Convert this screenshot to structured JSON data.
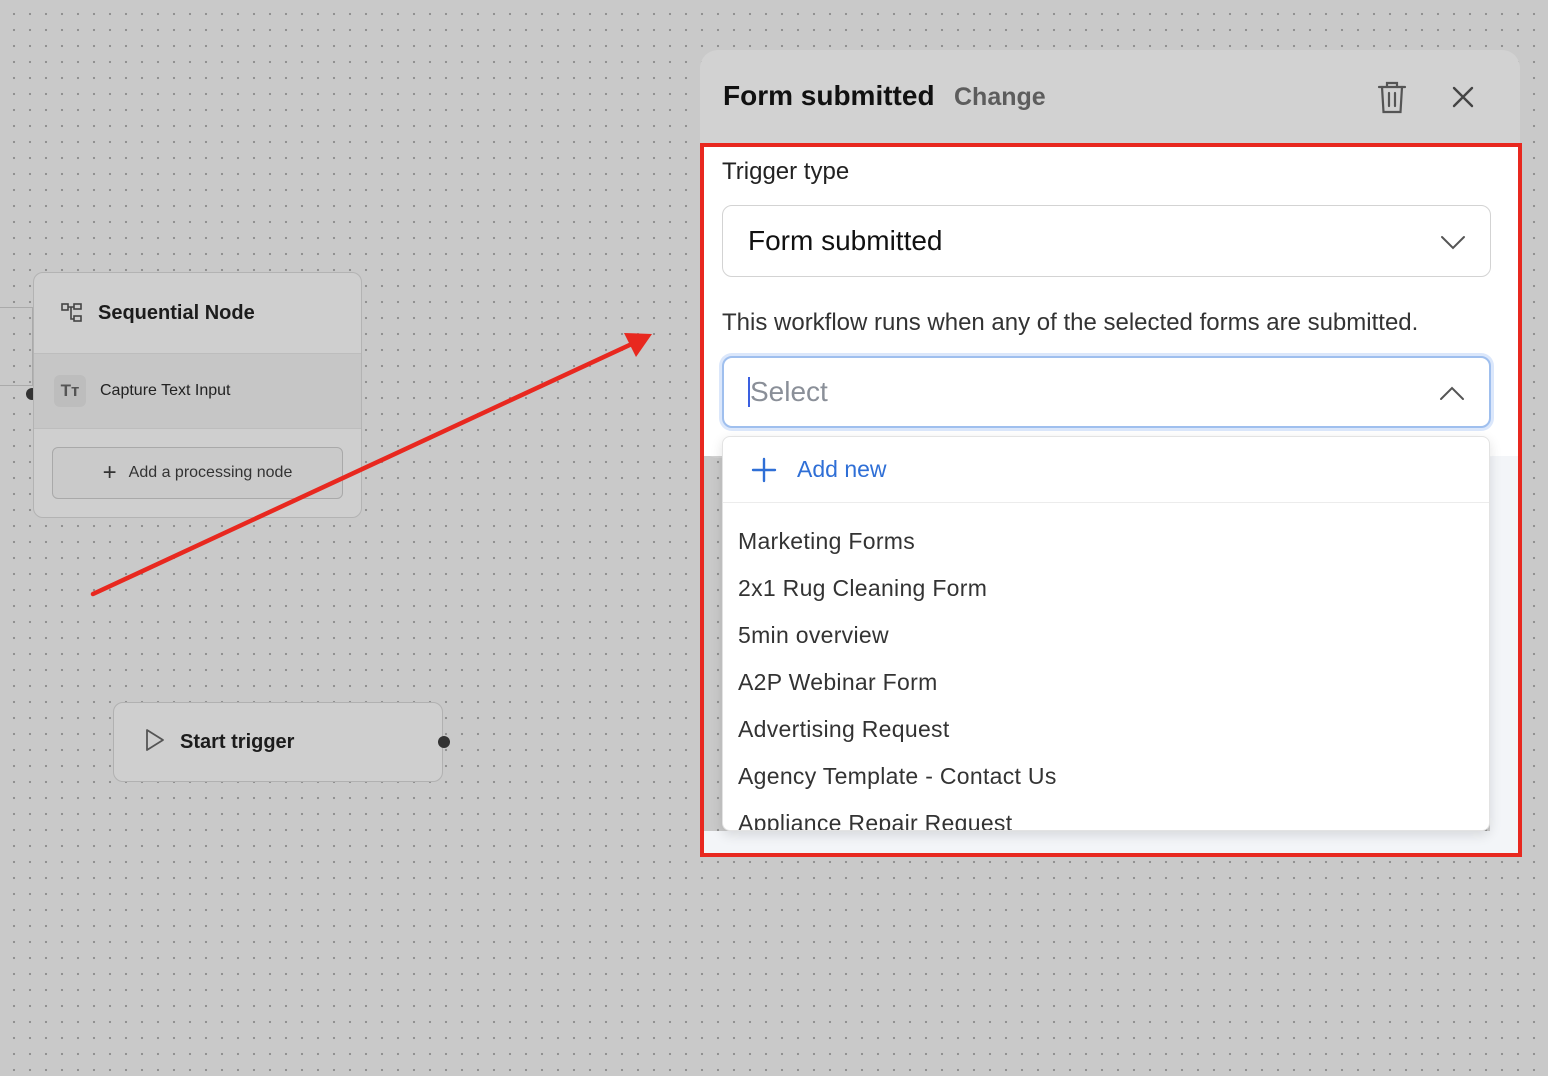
{
  "canvas": {
    "sequential_node": {
      "title": "Sequential Node",
      "item_label": "Capture Text Input",
      "item_icon": "text-type-icon",
      "item_icon_glyph": "Tт",
      "add_button_label": "Add a processing node"
    },
    "start_node": {
      "label": "Start trigger"
    }
  },
  "panel": {
    "title": "Form submitted",
    "change_label": "Change",
    "trigger_type_label": "Trigger type",
    "trigger_type_value": "Form submitted",
    "description": "This workflow runs when any of the selected forms are submitted.",
    "forms_select_placeholder": "Select",
    "dropdown": {
      "add_new_label": "Add new",
      "options": [
        "Marketing Forms",
        "2x1 Rug Cleaning Form",
        "5min overview",
        "A2P Webinar Form",
        "Advertising Request",
        "Agency Template - Contact Us",
        "Appliance Repair Request"
      ]
    }
  },
  "colors": {
    "annotation_red": "#e8281f",
    "link_blue": "#2f6fd6",
    "focus_blue": "#9fbfee",
    "canvas_gray": "#c9c9c9"
  }
}
